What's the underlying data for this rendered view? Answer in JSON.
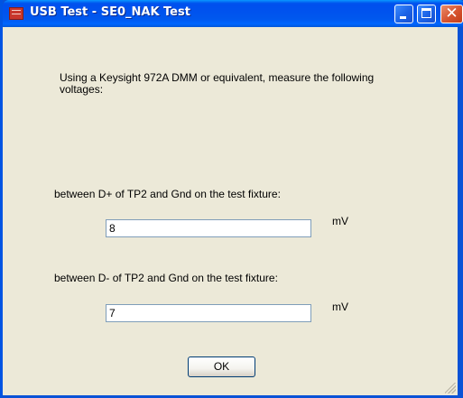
{
  "window": {
    "title": "USB Test - SE0_NAK Test",
    "colors": {
      "titlebar": "#0053ee",
      "client_background": "#ece9d8",
      "close_button": "#d6532f"
    }
  },
  "titlebar_icons": {
    "app": "app-icon",
    "minimize": "minimize-icon",
    "maximize": "maximize-icon",
    "close": "close-icon"
  },
  "dialog": {
    "instructions": "Using a Keysight 972A DMM or equivalent, measure the following voltages:",
    "dplus_label": "between D+ of TP2 and Gnd on the test fixture:",
    "dplus_value": "8",
    "dplus_unit": "mV",
    "dminus_label": "between D- of TP2 and Gnd on the test fixture:",
    "dminus_value": "7",
    "dminus_unit": "mV",
    "ok_label": "OK"
  }
}
